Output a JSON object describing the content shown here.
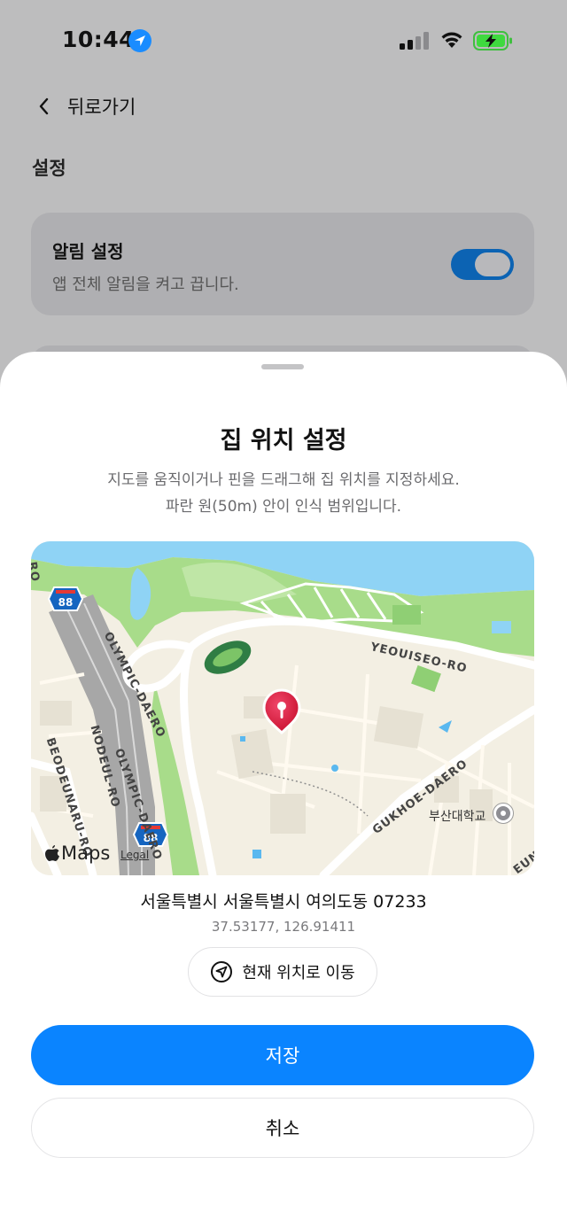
{
  "status_bar": {
    "time": "10:44",
    "icons": [
      "location-arrow-icon",
      "cellular-signal-icon",
      "wifi-icon",
      "battery-charging-icon"
    ]
  },
  "background": {
    "back_label": "뒤로가기",
    "section_title": "설정",
    "notification_setting": {
      "title": "알림 설정",
      "description": "앱 전체 알림을 켜고 끕니다.",
      "enabled": true
    }
  },
  "sheet": {
    "title": "집 위치 설정",
    "description_line1": "지도를 움직이거나 핀을 드래그해 집 위치를 지정하세요.",
    "description_line2": "파란 원(50m) 안이 인식 범위입니다.",
    "map": {
      "labels": {
        "road_1": "YEOUISEO-RO",
        "road_2": "OLYMPIC-DAERO",
        "road_3": "OLYMPIC-DAERO",
        "road_4": "NODEUL-RO",
        "road_5": "BEODEUNARU-RO",
        "road_6": "GUKHOE-DAERO",
        "road_7": "EUN",
        "road_8": "RO",
        "highway_shield_1": "88",
        "highway_shield_2": "88"
      },
      "poi": "부산대학교",
      "brand": "Maps",
      "legal": "Legal"
    },
    "address": "서울특별시 서울특별시 여의도동 07233",
    "coordinates": "37.53177, 126.91411",
    "move_to_current_label": "현재 위치로 이동",
    "save_label": "저장",
    "cancel_label": "취소"
  },
  "colors": {
    "accent": "#0a84ff",
    "pin": "#e0173c",
    "water": "#8fd3f5",
    "park": "#a8dc8a",
    "toggle_on": "#0c63b3"
  }
}
